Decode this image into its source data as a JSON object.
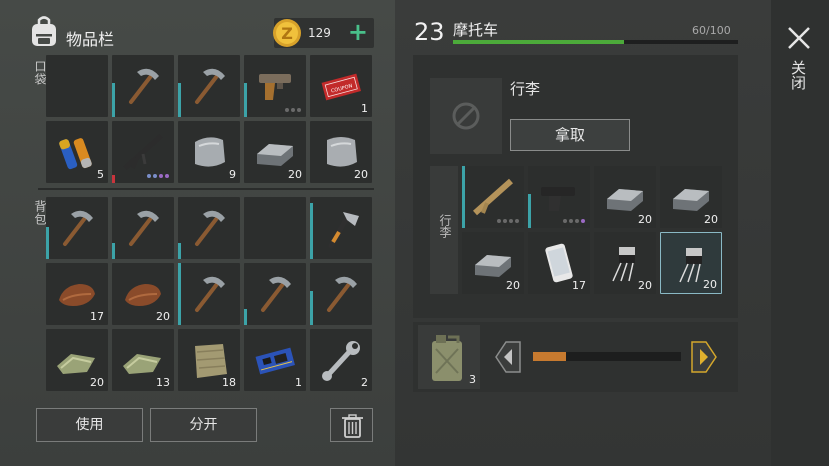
{
  "inventory": {
    "title": "物品栏",
    "coins": "129",
    "pocket_label": "口袋",
    "backpack_label": "背包",
    "pocket": [
      {
        "icon": "empty-slot",
        "qty": ""
      },
      {
        "icon": "pickaxe-icon",
        "qty": ""
      },
      {
        "icon": "pickaxe-icon",
        "qty": ""
      },
      {
        "icon": "pistol-icon",
        "qty": ""
      },
      {
        "icon": "coupon-icon",
        "qty": "1"
      },
      {
        "icon": "batteries-icon",
        "qty": "5"
      },
      {
        "icon": "assault-rifle-icon",
        "qty": ""
      },
      {
        "icon": "scrap-metal-icon",
        "qty": "9"
      },
      {
        "icon": "iron-ingot-icon",
        "qty": "20"
      },
      {
        "icon": "scrap-metal-icon",
        "qty": "20"
      }
    ],
    "backpack": [
      {
        "icon": "pickaxe-icon",
        "qty": ""
      },
      {
        "icon": "pickaxe-icon",
        "qty": ""
      },
      {
        "icon": "pickaxe-icon",
        "qty": ""
      },
      {
        "icon": "empty-slot",
        "qty": ""
      },
      {
        "icon": "hatchet-icon",
        "qty": ""
      },
      {
        "icon": "leather-icon",
        "qty": "17"
      },
      {
        "icon": "leather-icon",
        "qty": "20"
      },
      {
        "icon": "pickaxe-icon",
        "qty": ""
      },
      {
        "icon": "pickaxe-icon",
        "qty": ""
      },
      {
        "icon": "pickaxe-icon",
        "qty": ""
      },
      {
        "icon": "cloth-icon",
        "qty": "20"
      },
      {
        "icon": "cloth-icon",
        "qty": "13"
      },
      {
        "icon": "burlap-icon",
        "qty": "18"
      },
      {
        "icon": "circuit-board-icon",
        "qty": "1"
      },
      {
        "icon": "wrench-icon",
        "qty": "2"
      }
    ],
    "use_label": "使用",
    "split_label": "分开"
  },
  "vehicle": {
    "level": "23",
    "name": "摩托车",
    "capacity": "60/100",
    "capacity_fraction": 0.6,
    "luggage_title": "行李",
    "take_label": "拿取",
    "luggage_side_label": "行李",
    "luggage": [
      {
        "icon": "scar-rifle-icon",
        "qty": ""
      },
      {
        "icon": "glock-pistol-icon",
        "qty": ""
      },
      {
        "icon": "iron-ingot-icon",
        "qty": "20"
      },
      {
        "icon": "iron-ingot-icon",
        "qty": "20"
      },
      {
        "icon": "iron-ingot-icon",
        "qty": "20"
      },
      {
        "icon": "smartphone-icon",
        "qty": "17"
      },
      {
        "icon": "transistor-icon",
        "qty": "20"
      },
      {
        "icon": "transistor-icon",
        "qty": "20"
      }
    ],
    "fuel_qty": "3",
    "fuel_fraction": 0.22
  },
  "close_label": "关闭",
  "colors": {
    "accent_green": "#4caa3a",
    "plus_green": "#49c08a",
    "fuel_orange": "#c77a2f",
    "arrow_yellow": "#d4a72c",
    "durability_teal": "#3ca3a8"
  }
}
